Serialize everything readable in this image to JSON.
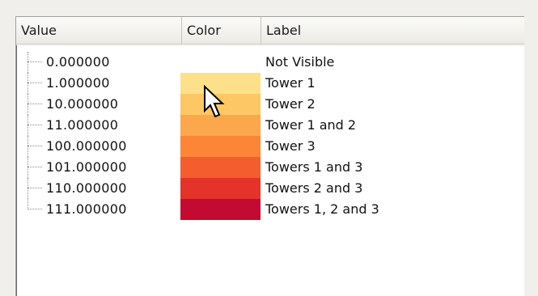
{
  "headers": {
    "value": "Value",
    "color": "Color",
    "label": "Label"
  },
  "rows": [
    {
      "value": "0.000000",
      "color": "",
      "label": "Not Visible"
    },
    {
      "value": "1.000000",
      "color": "#fde08a",
      "label": "Tower 1"
    },
    {
      "value": "10.000000",
      "color": "#fdc766",
      "label": "Tower 2"
    },
    {
      "value": "11.000000",
      "color": "#fda74c",
      "label": "Tower 1 and 2"
    },
    {
      "value": "100.000000",
      "color": "#fb8638",
      "label": "Tower 3"
    },
    {
      "value": "101.000000",
      "color": "#f45e2e",
      "label": "Towers 1 and 3"
    },
    {
      "value": "110.000000",
      "color": "#e3332a",
      "label": "Towers 2 and 3"
    },
    {
      "value": "111.000000",
      "color": "#c30a31",
      "label": "Towers 1, 2 and 3"
    }
  ],
  "cursor": {
    "icon": "mouse-pointer-icon"
  }
}
